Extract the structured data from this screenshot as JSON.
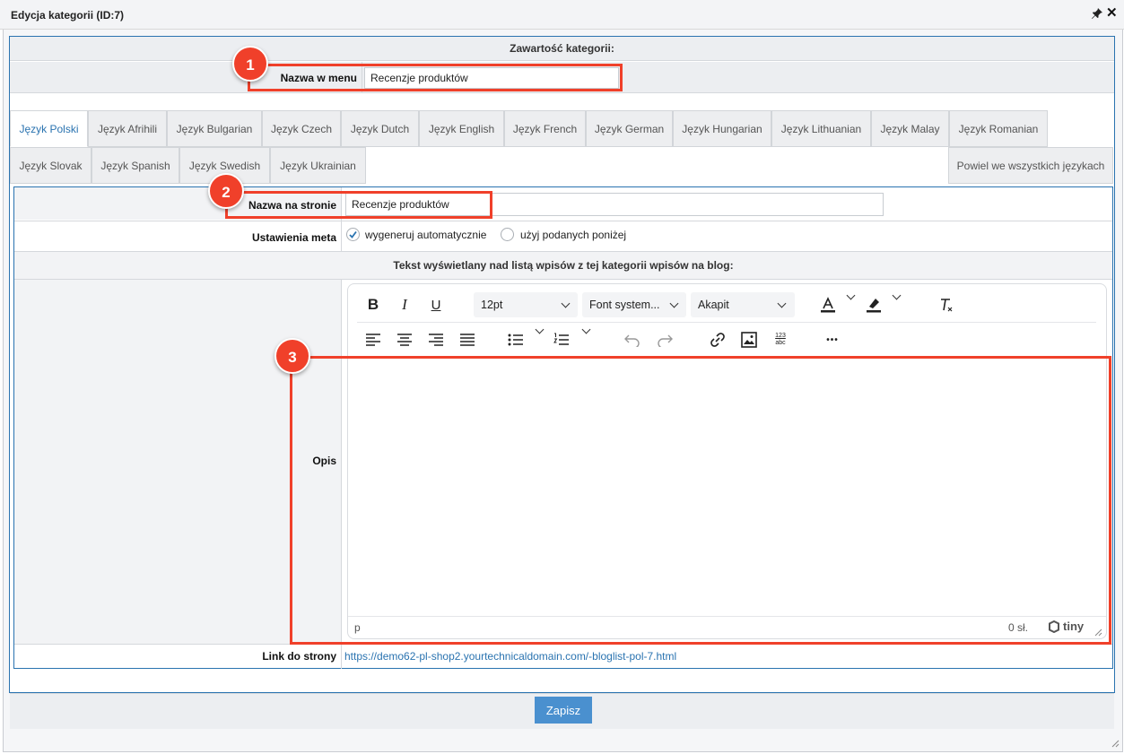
{
  "window": {
    "title": "Edycja kategorii (ID:7)"
  },
  "section": {
    "header": "Zawartość kategorii:"
  },
  "menu_name": {
    "label": "Nazwa w menu",
    "value": "Recenzje produktów"
  },
  "tabs": {
    "row1": [
      "Język Polski",
      "Język Afrihili",
      "Język Bulgarian",
      "Język Czech",
      "Język Dutch",
      "Język English",
      "Język French",
      "Język German",
      "Język Hungarian",
      "Język Lithuanian",
      "Język Malay",
      "Język Romanian"
    ],
    "row2": [
      "Język Slovak",
      "Język Spanish",
      "Język Swedish",
      "Język Ukrainian"
    ],
    "repeat_all": "Powiel we wszystkich językach",
    "active": "Język Polski"
  },
  "page_name": {
    "label": "Nazwa na stronie",
    "value": "Recenzje produktów"
  },
  "meta": {
    "label": "Ustawienia meta",
    "option_auto": "wygeneruj automatycznie",
    "option_manual": "użyj podanych poniżej",
    "selected": "wygeneruj automatycznie"
  },
  "description_header": "Tekst wyświetlany nad listą wpisów z tej kategorii wpisów na blog:",
  "description": {
    "label": "Opis"
  },
  "editor": {
    "font_size": "12pt",
    "font_family": "Font system...",
    "block_format": "Akapit",
    "status_path": "p",
    "word_count": "0 sł.",
    "brand": "tiny",
    "bold_glyph": "B",
    "italic_glyph": "I",
    "underline_glyph": "U",
    "more_glyph": "•••",
    "spellcheck_glyph_top": "123",
    "spellcheck_glyph_bottom": "abc"
  },
  "link": {
    "label": "Link do strony",
    "url": "https://demo62-pl-shop2.yourtechnicaldomain.com/-bloglist-pol-7.html"
  },
  "save_button": "Zapisz",
  "annotations": [
    "1",
    "2",
    "3"
  ],
  "colors": {
    "accent": "#2a73b0",
    "annotation": "#f0402a",
    "button": "#4a90cf"
  }
}
